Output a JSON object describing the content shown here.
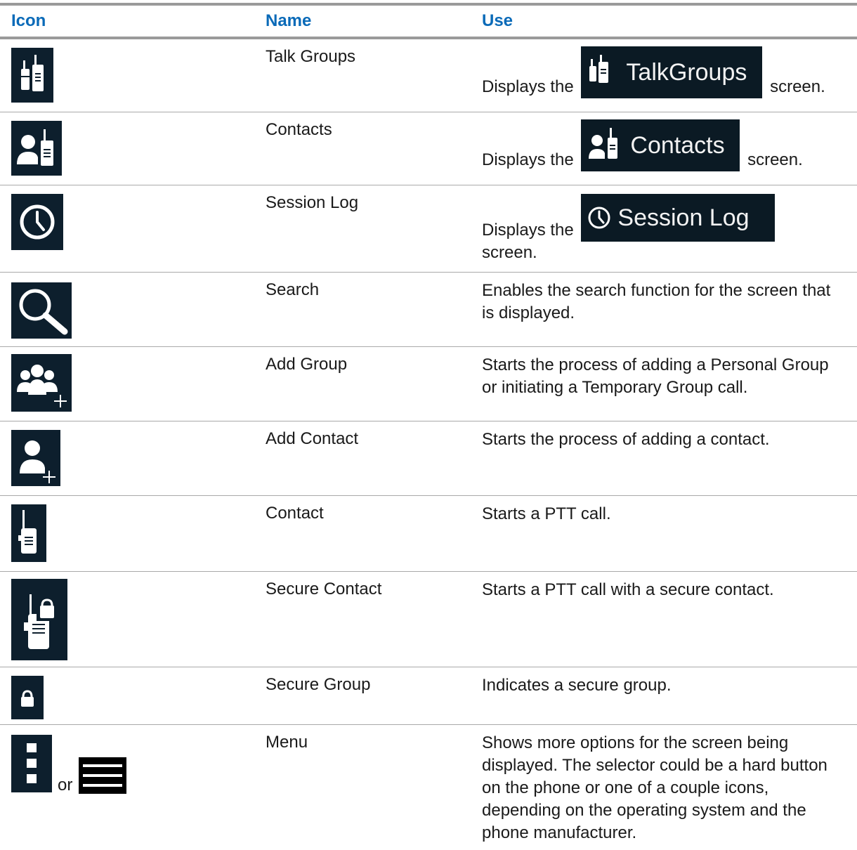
{
  "headers": {
    "icon": "Icon",
    "name": "Name",
    "use": "Use"
  },
  "rows": [
    {
      "icon": "talkgroups-radio-icon",
      "name": "Talk Groups",
      "use_before": "Displays the",
      "screen_label": "TalkGroups",
      "use_after": "screen."
    },
    {
      "icon": "contacts-person-radio-icon",
      "name": "Contacts",
      "use_before": "Displays the",
      "screen_label": "Contacts",
      "use_after": "screen."
    },
    {
      "icon": "clock-icon",
      "name": "Session Log",
      "use_before": "Displays the",
      "screen_label": "Session Log",
      "use_after": "screen."
    },
    {
      "icon": "search-icon",
      "name": "Search",
      "use": "Enables the search function for the screen that is displayed."
    },
    {
      "icon": "add-group-icon",
      "name": "Add Group",
      "use": "Starts the process of adding a Personal Group or initiating a Temporary Group call."
    },
    {
      "icon": "add-contact-icon",
      "name": "Add Contact",
      "use": "Starts the process of adding a contact."
    },
    {
      "icon": "radio-contact-icon",
      "name": "Contact",
      "use": "Starts a PTT call."
    },
    {
      "icon": "secure-radio-contact-icon",
      "name": "Secure Contact",
      "use": "Starts a PTT call with a secure contact."
    },
    {
      "icon": "lock-icon",
      "name": "Secure Group",
      "use": "Indicates a secure group."
    },
    {
      "icon": "kebab-menu-icon",
      "icon_alt": "hamburger-menu-icon",
      "or_text": "or",
      "name": "Menu",
      "use": "Shows more options for the screen being displayed. The selector could be a hard button on the phone or one of a couple icons, depending on the operating system and the phone manufacturer."
    }
  ],
  "colors": {
    "header_text": "#0a6ab8",
    "icon_bg": "#0d1f2d",
    "rule": "#9a9a9a"
  }
}
